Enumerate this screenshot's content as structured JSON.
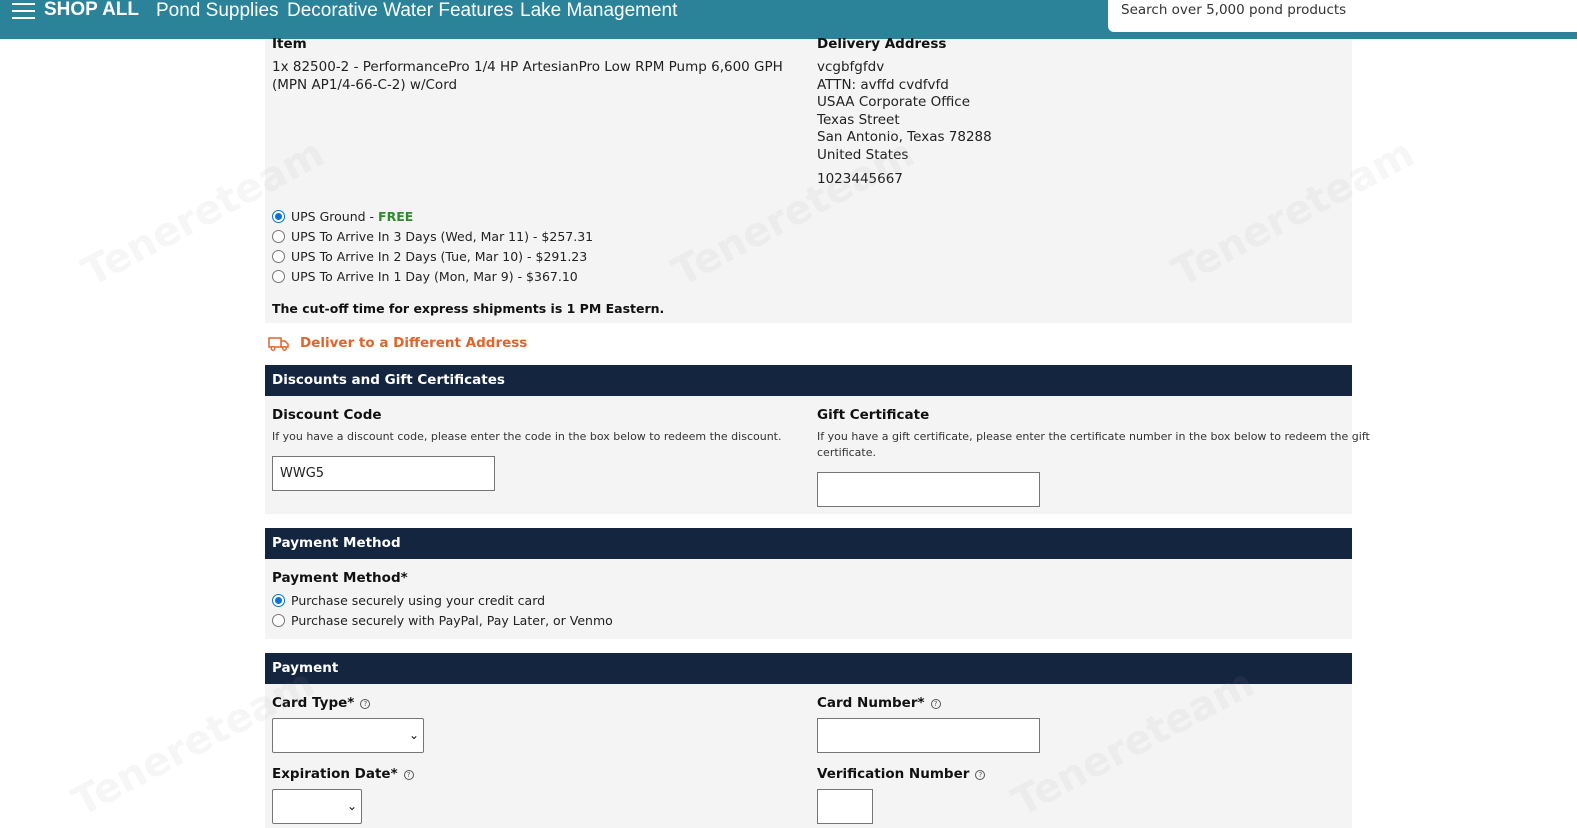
{
  "nav": {
    "shop_all": "SHOP ALL",
    "links": [
      "Pond Supplies",
      "Decorative Water Features",
      "Lake Management"
    ],
    "search_placeholder": "Search over 5,000 pond products"
  },
  "order": {
    "item_heading": "Item",
    "item_line1": "1x 82500-2 - PerformancePro 1/4 HP ArtesianPro Low RPM Pump 6,600 GPH",
    "item_line2": "(MPN AP1/4-66-C-2) w/Cord",
    "delivery_heading": "Delivery Address",
    "address": [
      "vcgbfgfdv",
      "ATTN: avffd cvdfvfd",
      "USAA Corporate Office",
      "Texas Street",
      "San Antonio, Texas 78288",
      "United States"
    ],
    "phone": "1023445667"
  },
  "shipping": {
    "options": [
      {
        "label": "UPS Ground - ",
        "extra": "FREE",
        "checked": true
      },
      {
        "label": "UPS To Arrive In 3 Days (Wed, Mar 11) - $257.31",
        "extra": "",
        "checked": false
      },
      {
        "label": "UPS To Arrive In 2 Days (Tue, Mar 10) - $291.23",
        "extra": "",
        "checked": false
      },
      {
        "label": "UPS To Arrive In 1 Day (Mon, Mar 9) - $367.10",
        "extra": "",
        "checked": false
      }
    ],
    "cutoff_note": "The cut-off time for express shipments is 1 PM Eastern.",
    "different_address_link": "Deliver to a Different Address"
  },
  "discounts": {
    "header": "Discounts and Gift Certificates",
    "discount_label": "Discount Code",
    "discount_help": "If you have a discount code, please enter the code in the box below to redeem the discount.",
    "discount_value": "WWG5",
    "gift_label": "Gift Certificate",
    "gift_help_line1": "If you have a gift certificate, please enter the certificate number in the box below to redeem the gift",
    "gift_help_line2": "certificate.",
    "gift_value": ""
  },
  "payment_method": {
    "header": "Payment Method",
    "label": "Payment Method*",
    "options": [
      {
        "label": "Purchase securely using your credit card",
        "checked": true
      },
      {
        "label": "Purchase securely with PayPal, Pay Later, or Venmo",
        "checked": false
      }
    ]
  },
  "payment": {
    "header": "Payment",
    "card_type_label": "Card Type*",
    "card_number_label": "Card Number*",
    "expiration_label": "Expiration Date*",
    "verification_label": "Verification Number"
  },
  "watermark_text": "Tenereteam",
  "colors": {
    "topbar": "#2a8399",
    "section_header": "#14253f",
    "link_orange": "#e0652a",
    "free_green": "#2e8b2e",
    "radio_blue": "#0a72d4"
  }
}
